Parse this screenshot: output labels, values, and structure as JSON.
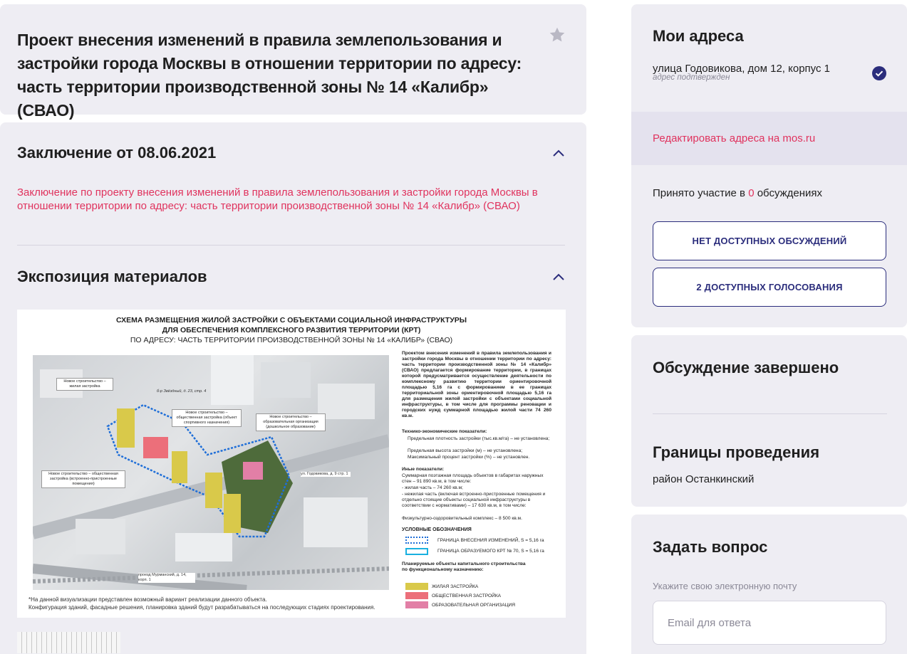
{
  "project": {
    "title": "Проект внесения изменений в правила землепользования и застройки города Москвы в отношении территории по адресу: часть территории производственной зоны № 14 «Калибр» (СВАО)",
    "favorite_icon": "star-icon"
  },
  "conclusion": {
    "heading": "Заключение от 08.06.2021",
    "link_text": "Заключение по проекту внесения изменений в правила землепользования и застройки города Москвы в отношении территории по адресу: часть территории производственной зоны № 14 «Калибр» (СВАО)"
  },
  "exposition": {
    "heading": "Экспозиция материалов",
    "scheme": {
      "title_line1": "СХЕМА РАЗМЕЩЕНИЯ ЖИЛОЙ ЗАСТРОЙКИ С ОБЪЕКТАМИ СОЦИАЛЬНОЙ ИНФРАСТРУКТУРЫ",
      "title_line2": "ДЛЯ ОБЕСПЕЧЕНИЯ КОМПЛЕКСНОГО РАЗВИТИЯ ТЕРРИТОРИИ (КРТ)",
      "title_line3": "ПО АДРЕСУ: ЧАСТЬ ТЕРРИТОРИИ ПРОИЗВОДСТВЕННОЙ ЗОНЫ № 14 «КАЛИБР» (СВАО)",
      "callout_1": "Новое строительство – жилая застройка",
      "callout_2": "Новое строительство – общественная застройка (объект спортивного назначения)",
      "callout_3": "Новое строительство – образовательная организация (дошкольное образование)",
      "callout_4": "Новое строительство – общественная застройка (встроенно-пристроенные помещения)",
      "street_1": "б-р Звёздный, д. 23, стр. 4",
      "street_2": "ул. Годовикова, д. 9 стр. 1",
      "street_3": "проезд Мурманский, д. 14, корп. 1",
      "description": "Проектом внесения изменений в правила землепользования и застройки города Москвы в отношении территории по адресу: часть территории производственной зоны № 14 «Калибр» (СВАО) предлагается формирование территории, в границах которой предусматривается осуществление деятельности по комплексному развитию территории ориентировочной площадью 5,16 га с формированием в ее границах территориальной зоны ориентировочной площадью 5,16 га для размещения жилой застройки с объектами социальной инфраструктуры, в том числе для программы реновации и городских нужд суммарной площадью жилой части 74 260 кв.м.",
      "tep_heading": "Технико-экономические показатели:",
      "tep_1": "Предельная плотность застройки (тыс.кв.м/га) – не установлена;",
      "tep_2": "Предельная высота застройки (м) – не установлена;",
      "tep_3": "Максимальный процент застройки (%) – не установлен.",
      "other_heading": "Иные показатели:",
      "other_1": "Суммарная поэтажная площадь объектов в габаритах наружных стен – 91 890 кв.м, в том числе:",
      "other_2": "- жилая часть – 74 260 кв.м;",
      "other_3": "- нежилая часть (включая встроенно-пристроенные помещения и отдельно стоящие объекты социальной инфраструктуры в соответствии с нормативами) – 17 630 кв.м, в том числе:",
      "other_4": "Физкультурно-оздоровительный комплекс – 8 500 кв.м.",
      "legend_heading": "УСЛОВНЫЕ ОБОЗНАЧЕНИЯ",
      "legend_1": "ГРАНИЦА ВНЕСЕНИЯ ИЗМЕНЕНИЙ, S = 5,16 га",
      "legend_2": "ГРАНИЦА ОБРАЗУЕМОГО КРТ № 70, S = 5,16 га",
      "planned_heading": "Планируемые объекты капитального строительства по функциональному назначению:",
      "planned_1": "ЖИЛАЯ ЗАСТРОЙКА",
      "planned_2": "ОБЩЕСТВЕННАЯ ЗАСТРОЙКА",
      "planned_3": "ОБРАЗОВАТЕЛЬНАЯ ОРГАНИЗАЦИЯ",
      "footnote_1": "*На данной визуализации представлен возможный вариант реализации данного объекта.",
      "footnote_2": "Конфигурация зданий, фасадные решения, планировка зданий будут разрабатываться на последующих стадиях проектирования."
    }
  },
  "my_addresses": {
    "heading": "Мои адреса",
    "street": "улица Годовикова, дом 12, корпус 1",
    "status": "адрес подтвержден",
    "edit_link": "Редактировать адреса на mos.ru",
    "participation_prefix": "Принято участие в",
    "participation_count": "0",
    "participation_suffix": "обсуждениях",
    "btn_discussions": "НЕТ ДОСТУПНЫХ ОБСУЖДЕНИЙ",
    "btn_votes": "2 ДОСТУПНЫХ ГОЛОСОВАНИЯ"
  },
  "discussion": {
    "status_heading": "Обсуждение завершено",
    "bounds_heading": "Границы проведения",
    "bounds_value": "район Останкинский"
  },
  "question": {
    "heading": "Задать вопрос",
    "email_label": "Укажите свою электронную почту",
    "email_placeholder": "Email для ответа",
    "email_value": ""
  },
  "colors": {
    "accent_pink": "#e0335e",
    "navy": "#2b2d7c",
    "card_bg": "#eeedf3",
    "residential": "#d9c94a",
    "public": "#ec6f7a",
    "education": "#e27fa6"
  }
}
